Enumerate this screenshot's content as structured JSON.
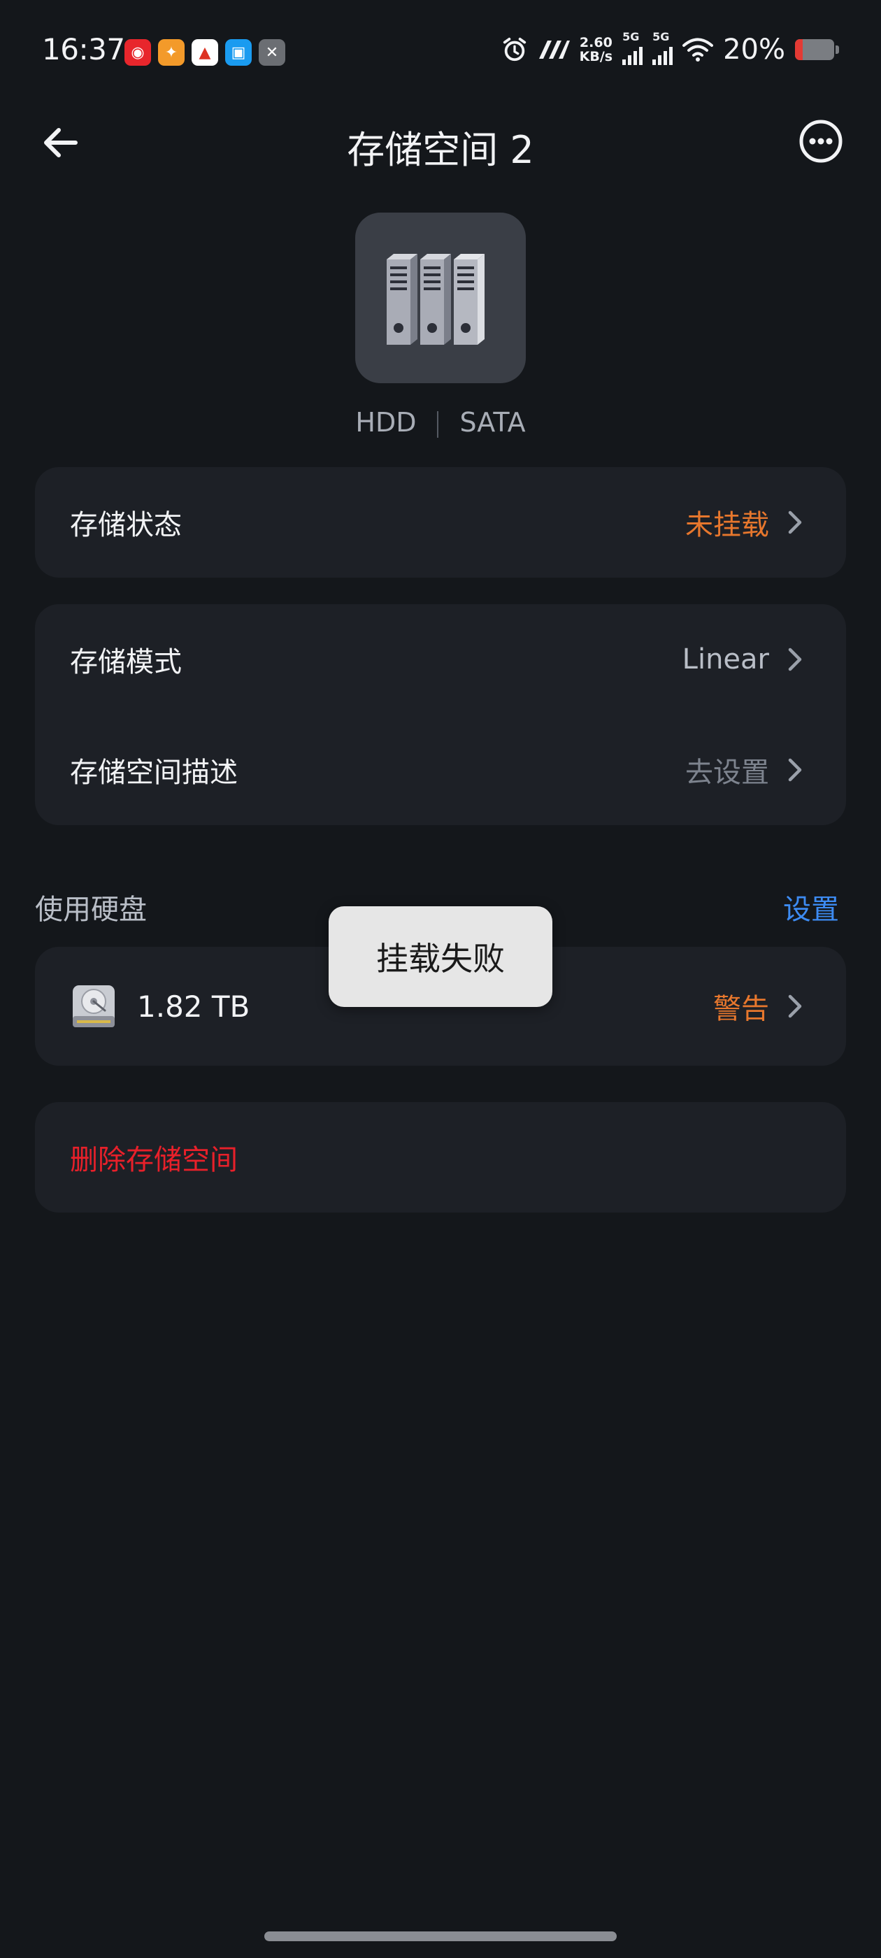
{
  "status_bar": {
    "time": "16:37",
    "net_speed_value": "2.60",
    "net_speed_unit": "KB/s",
    "sim1": "5G",
    "sim2": "5G",
    "battery_percent": "20%",
    "battery_level": 0.2,
    "battery_color": "#e43a34",
    "notification_icons": [
      "netease-music-icon",
      "taobao-icon",
      "news-icon",
      "app-icon",
      "capcut-icon"
    ]
  },
  "header": {
    "title": "存储空间 2",
    "back_icon": "arrow-left-icon",
    "more_icon": "more-circle-icon"
  },
  "device": {
    "icon": "hdd-rack-icon",
    "type": "HDD",
    "interface": "SATA"
  },
  "status_card": {
    "label": "存储状态",
    "value": "未挂载",
    "value_color": "#e7772d"
  },
  "settings_card": {
    "mode_label": "存储模式",
    "mode_value": "Linear",
    "desc_label": "存储空间描述",
    "desc_value": "去设置"
  },
  "disks_section": {
    "title": "使用硬盘",
    "action": "设置",
    "disk_size": "1.82 TB",
    "disk_status": "警告",
    "disk_icon": "hard-disk-icon"
  },
  "delete_card": {
    "label": "删除存储空间",
    "color": "#e8202a"
  },
  "toast": {
    "message": "挂载失败"
  }
}
